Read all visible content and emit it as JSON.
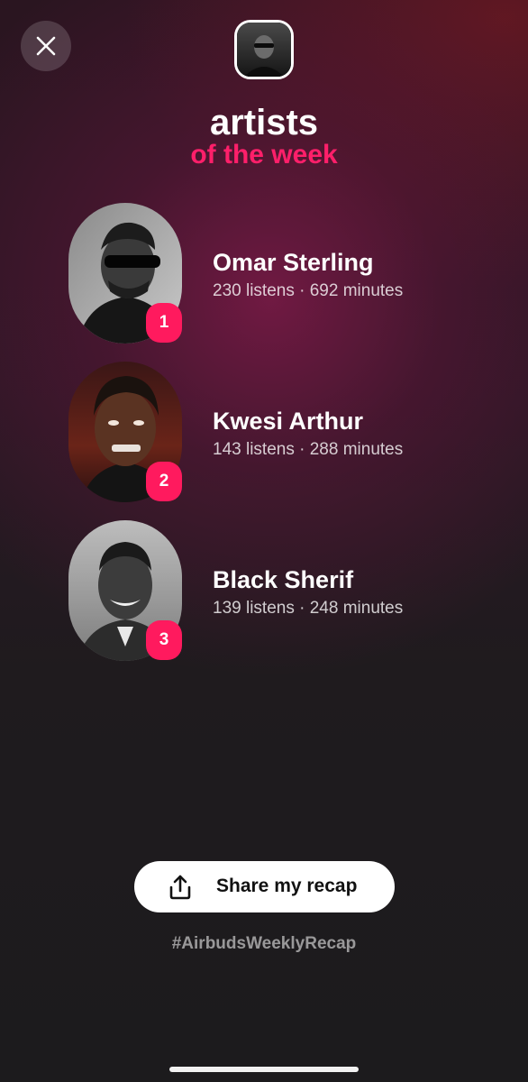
{
  "header": {
    "close_icon": "close-icon",
    "avatar_icon": "user-avatar"
  },
  "title": {
    "main": "artists",
    "sub": "of the week",
    "sub_color": "#ff1f6a"
  },
  "artists": [
    {
      "rank": "1",
      "name": "Omar Sterling",
      "stats": "230 listens · 692 minutes"
    },
    {
      "rank": "2",
      "name": "Kwesi Arthur",
      "stats": "143 listens · 288 minutes"
    },
    {
      "rank": "3",
      "name": "Black Sherif",
      "stats": "139 listens · 248 minutes"
    }
  ],
  "share": {
    "label": "Share my recap",
    "icon": "share-icon"
  },
  "hashtag": "#AirbudsWeeklyRecap",
  "colors": {
    "accent": "#ff1a5e",
    "background_top": "#2a1520",
    "background_bottom": "#1c1b1d"
  }
}
